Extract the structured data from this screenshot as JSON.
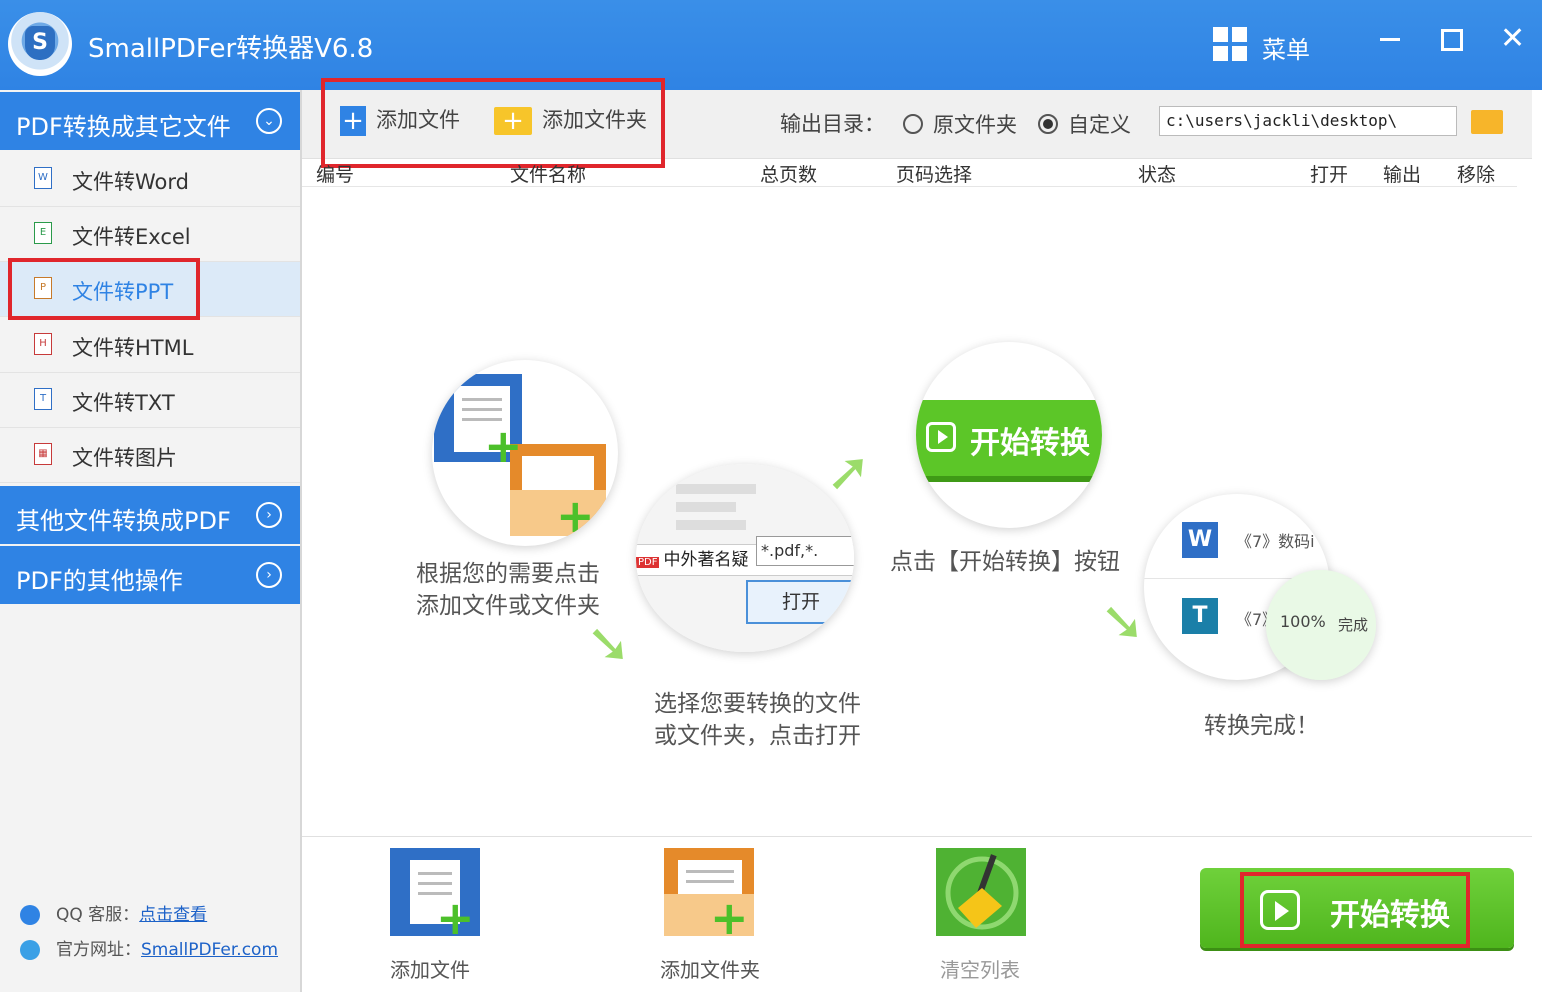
{
  "window": {
    "title": "SmallPDFer转换器V6.8",
    "menu_label": "菜单",
    "close_glyph": "✕"
  },
  "sidebar": {
    "section1": "PDF转换成其它文件",
    "items": [
      {
        "label": "文件转Word",
        "icon": "W"
      },
      {
        "label": "文件转Excel",
        "icon": "E"
      },
      {
        "label": "文件转PPT",
        "icon": "P"
      },
      {
        "label": "文件转HTML",
        "icon": "H"
      },
      {
        "label": "文件转TXT",
        "icon": "T"
      },
      {
        "label": "文件转图片",
        "icon": "▦"
      }
    ],
    "section2": "其他文件转换成PDF",
    "section3": "PDF的其他操作",
    "qq_label": "QQ 客服：",
    "qq_link": "点击查看",
    "web_label": "官方网址：",
    "web_link": "SmallPDFer.com"
  },
  "toolbar": {
    "add_file": "添加文件",
    "add_folder": "添加文件夹",
    "output_label": "输出目录：",
    "radio_original": "原文件夹",
    "radio_custom": "自定义",
    "output_path": "c:\\users\\jackli\\desktop\\"
  },
  "table": {
    "columns": [
      "编号",
      "文件名称",
      "总页数",
      "页码选择",
      "状态",
      "打开",
      "输出",
      "移除"
    ]
  },
  "guide": {
    "step1_line1": "根据您的需要点击",
    "step1_line2": "添加文件或文件夹",
    "step2_line1": "选择您要转换的文件",
    "step2_line2": "或文件夹，点击打开",
    "step2_file": "中外著名疑",
    "step2_ext": "*.pdf,*.",
    "step2_open": "打开",
    "step3_button": "开始转换",
    "step3_text": "点击【开始转换】按钮",
    "step4_row1": "《7》数码i",
    "step4_row2": "《7》",
    "step4_progress": "100%",
    "step4_status": "完成",
    "step4_text": "转换完成！"
  },
  "bottom": {
    "add_file": "添加文件",
    "add_folder": "添加文件夹",
    "clear_list": "清空列表",
    "start": "开始转换"
  },
  "colors": {
    "primary_blue": "#2f83e4",
    "accent_green": "#5cc628",
    "highlight_red": "#e0262c"
  }
}
